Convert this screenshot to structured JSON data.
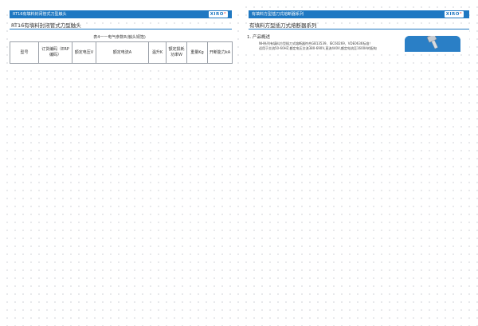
{
  "left_page": {
    "header": "RT16有填料封闭管式刀型触头",
    "logo_text": "XIRO",
    "section_title": "RT16有填料封闭管式刀型触头",
    "table": {
      "caption": "表4一一电气参数R(触头铜箔)",
      "headers": [
        "型号",
        "订货编码（ERP编码）",
        "额定电压V",
        "额定电流A",
        "温升K",
        "额定损耗功率W",
        "重量Kg",
        "开断能力kA"
      ]
    }
  },
  "right_page": {
    "header": "有填料方型插刀式熔断器系列",
    "logo_text": "XIRO",
    "section_title": "有填料方型插刀式熔断器系列",
    "overview_heading": "1. 产品概述",
    "overview_lines": [
      "NH系列有填料方型插刀式熔断器符合GB13539、IEC60269、VDE0636标准！",
      "适用于交流50-60HZ,额定电压交流380-690V,直流440V,额定电流至1600A的配电"
    ]
  }
}
